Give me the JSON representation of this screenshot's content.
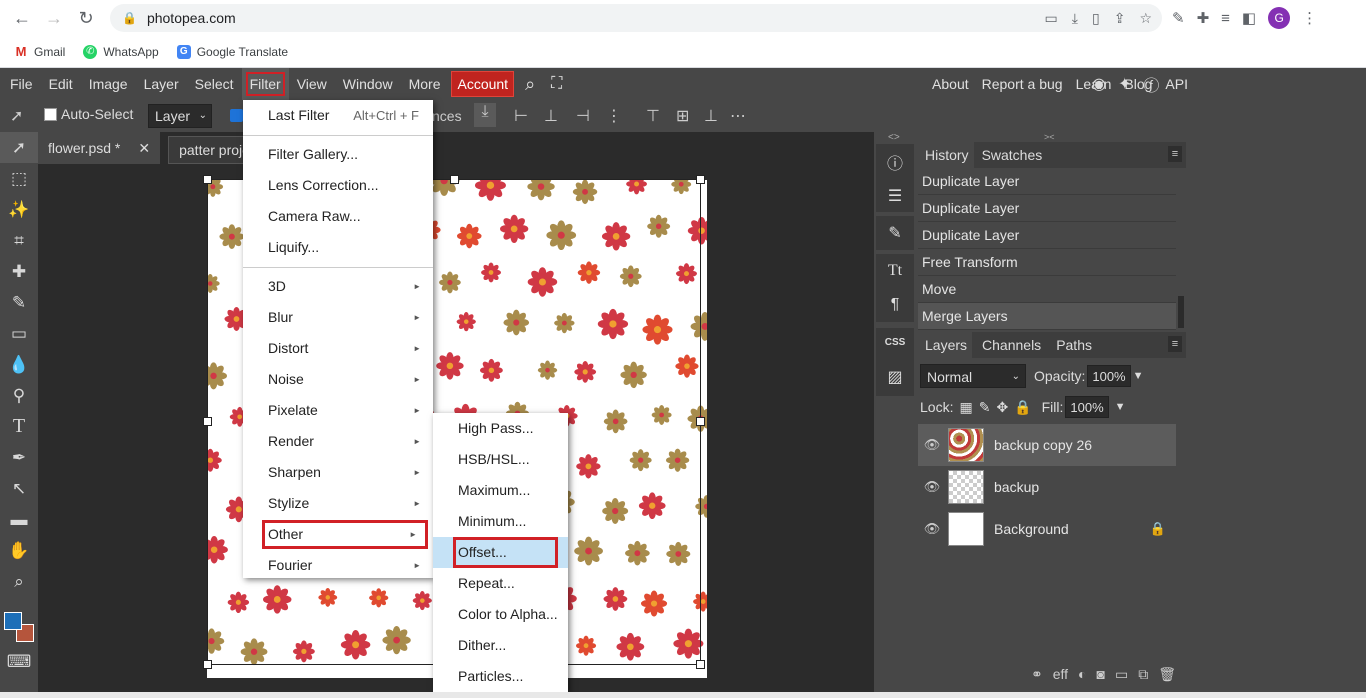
{
  "browser": {
    "url": "photopea.com",
    "avatar_letter": "G",
    "bookmarks": [
      {
        "label": "Gmail",
        "icon": "gmail-icon"
      },
      {
        "label": "WhatsApp",
        "icon": "whatsapp-icon"
      },
      {
        "label": "Google Translate",
        "icon": "google-translate-icon"
      }
    ]
  },
  "menubar": {
    "items": [
      "File",
      "Edit",
      "Image",
      "Layer",
      "Select",
      "Filter",
      "View",
      "Window",
      "More"
    ],
    "active_item": "Filter",
    "account_label": "Account",
    "right_links": [
      "About",
      "Report a bug",
      "Learn",
      "Blog",
      "API"
    ]
  },
  "options": {
    "autoselect_label": "Auto-Select",
    "autoselect_target": "Layer",
    "partial_label": "nces"
  },
  "tabs": [
    {
      "label": "flower.psd *",
      "close": "✕"
    },
    {
      "label": "patter projec"
    }
  ],
  "filter_menu": {
    "top_items": [
      {
        "label": "Last Filter",
        "shortcut": "Alt+Ctrl + F"
      }
    ],
    "mid_items": [
      "Filter Gallery...",
      "Lens Correction...",
      "Camera Raw...",
      "Liquify..."
    ],
    "sub_items": [
      "3D",
      "Blur",
      "Distort",
      "Noise",
      "Pixelate",
      "Render",
      "Sharpen",
      "Stylize",
      "Other",
      "Fourier"
    ],
    "highlighted": "Other"
  },
  "other_submenu": {
    "items": [
      "High Pass...",
      "HSB/HSL...",
      "Maximum...",
      "Minimum...",
      "Offset...",
      "Repeat...",
      "Color to Alpha...",
      "Dither...",
      "Particles..."
    ],
    "highlighted": "Offset..."
  },
  "history_panel": {
    "tabs": [
      "History",
      "Swatches"
    ],
    "items": [
      "Duplicate Layer",
      "Duplicate Layer",
      "Duplicate Layer",
      "Free Transform",
      "Move",
      "Merge Layers"
    ]
  },
  "layers_panel": {
    "tabs": [
      "Layers",
      "Channels",
      "Paths"
    ],
    "blend_mode": "Normal",
    "opacity_label": "Opacity:",
    "opacity_value": "100%",
    "lock_label": "Lock:",
    "fill_label": "Fill:",
    "fill_value": "100%",
    "layers": [
      {
        "name": "backup copy 26",
        "selected": true,
        "thumb": "pattern"
      },
      {
        "name": "backup",
        "selected": false,
        "thumb": "checker"
      },
      {
        "name": "Background",
        "selected": false,
        "thumb": "white",
        "locked": true
      }
    ]
  },
  "colors": {
    "foreground": "#1d6fb8",
    "background": "#b5553c",
    "highlight_box": "#d12026",
    "flower_red": "#d03845",
    "flower_gold": "#a88c4c",
    "flower_orange": "#e04a30"
  }
}
